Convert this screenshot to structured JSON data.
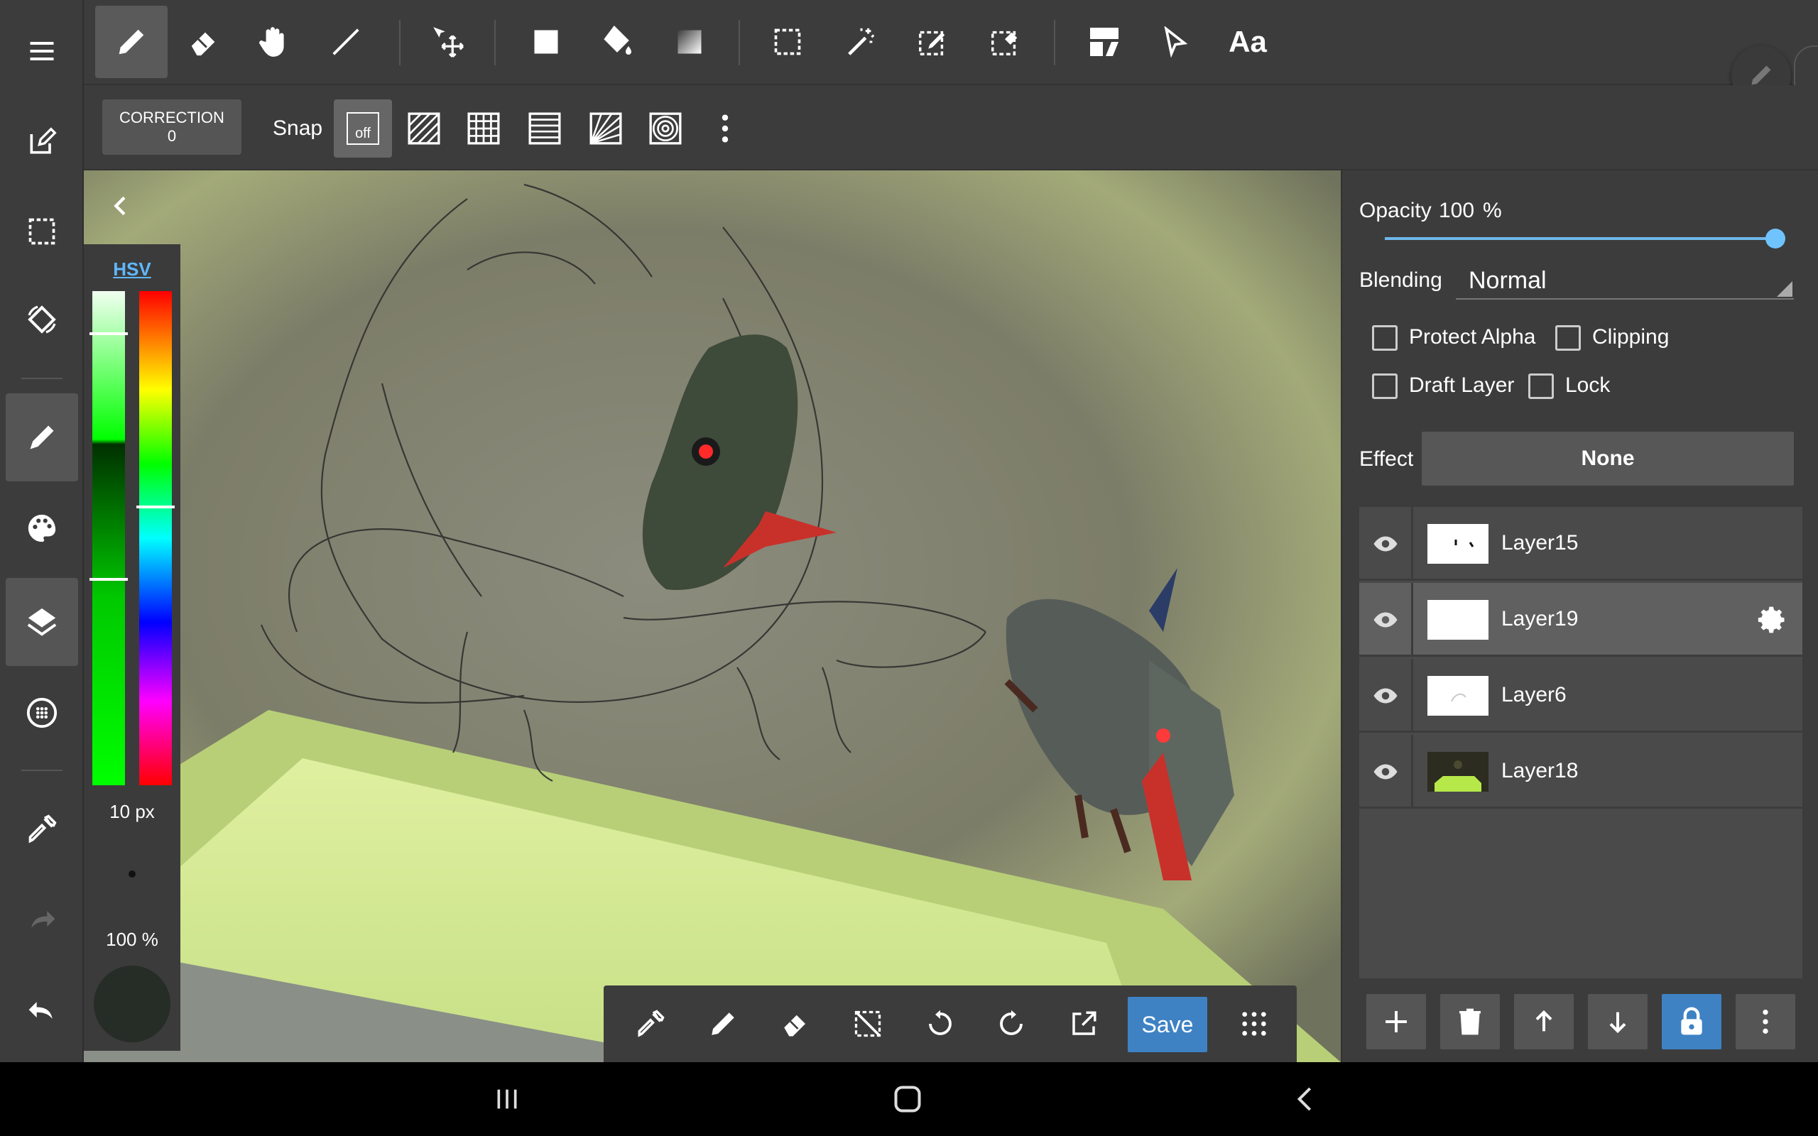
{
  "left_sidebar": {
    "items": [
      "menu-icon",
      "edit-canvas-icon",
      "selection-icon",
      "rotate-canvas-icon",
      "brush-icon",
      "palette-icon",
      "layers-icon",
      "material-icon",
      "eyedropper-icon",
      "redo-icon",
      "undo-icon"
    ],
    "active": [
      "brush-icon",
      "layers-icon"
    ]
  },
  "top_toolbar": {
    "tools": [
      "pen",
      "eraser",
      "hand",
      "line",
      "move",
      "fill-rect",
      "bucket",
      "gradient",
      "select-rect",
      "magic-wand",
      "select-pen",
      "select-eraser",
      "layer-panel",
      "pointer",
      "text"
    ],
    "active": "pen",
    "text_tool_label": "Aa"
  },
  "sub_toolbar": {
    "correction_label": "CORRECTION",
    "correction_value": "0",
    "snap_label": "Snap",
    "snap_off_label": "off",
    "snap_options": [
      "off",
      "parallel",
      "grid",
      "horizontal",
      "perspective",
      "concentric"
    ]
  },
  "color_panel": {
    "mode_label": "HSV",
    "brush_size": "10 px",
    "brush_opacity": "100 %",
    "current_color": "#262c26"
  },
  "bottom_tools": {
    "tools": [
      "eyedropper",
      "pen",
      "eraser",
      "deselect",
      "undo",
      "redo",
      "export"
    ],
    "save_label": "Save"
  },
  "layer_properties": {
    "opacity_label": "Opacity",
    "opacity_value": "100",
    "opacity_unit": "%",
    "opacity_level": 1.0,
    "blending_label": "Blending",
    "blending_value": "Normal",
    "protect_alpha": "Protect Alpha",
    "clipping": "Clipping",
    "draft_layer": "Draft Layer",
    "lock": "Lock",
    "effect_label": "Effect",
    "effect_value": "None"
  },
  "layers": [
    {
      "name": "Layer15",
      "selected": false
    },
    {
      "name": "Layer19",
      "selected": true
    },
    {
      "name": "Layer6",
      "selected": false
    },
    {
      "name": "Layer18",
      "selected": false
    }
  ],
  "layer_actions": [
    "add",
    "delete",
    "move-up",
    "move-down",
    "lock",
    "more"
  ],
  "colors": {
    "accent": "#3e82c4",
    "slider": "#6fb8ec",
    "link": "#5fb8ff"
  }
}
